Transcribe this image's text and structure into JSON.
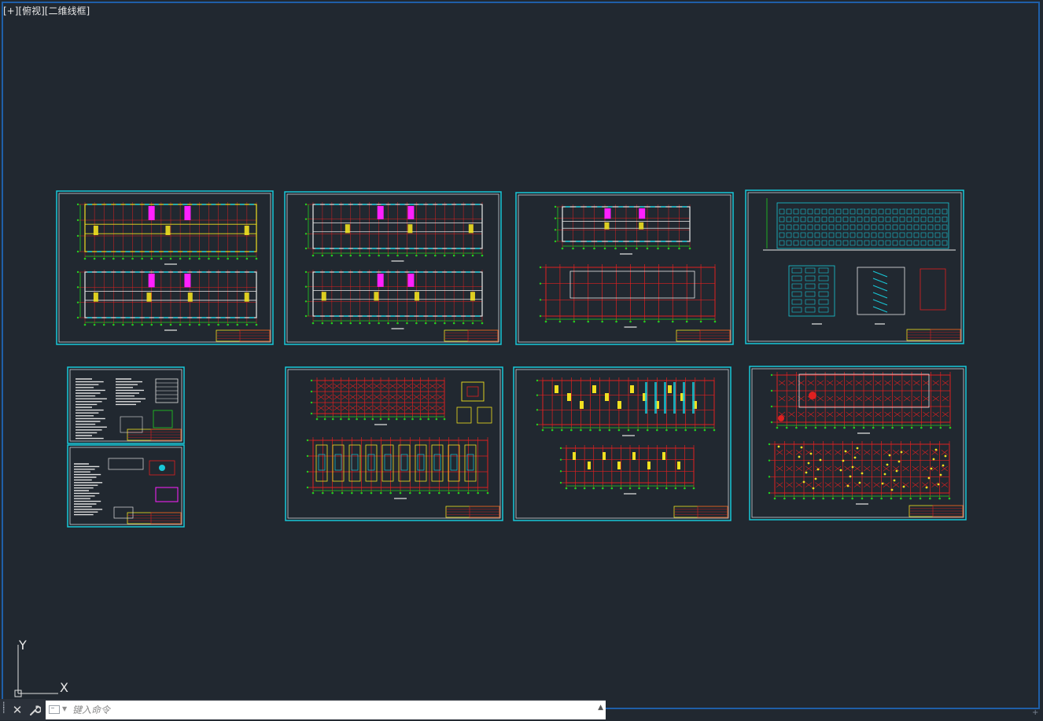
{
  "viewport": {
    "label_parts": [
      "[+]",
      "[俯视]",
      "[二维线框]"
    ],
    "background_color": "#212830"
  },
  "ucs": {
    "x_label": "X",
    "y_label": "Y"
  },
  "command_line": {
    "placeholder": "键入命令",
    "close_icon": "close-icon",
    "settings_icon": "wrench-icon",
    "prompt_icon": "command-prompt-icon",
    "history_icon": "chevron-up-icon"
  },
  "sheets": [
    {
      "id": "sheet-1",
      "kind": "floor-plans"
    },
    {
      "id": "sheet-2",
      "kind": "floor-plans"
    },
    {
      "id": "sheet-3",
      "kind": "plan-and-roof"
    },
    {
      "id": "sheet-4",
      "kind": "elevations-sections"
    },
    {
      "id": "sheet-5",
      "kind": "notes"
    },
    {
      "id": "sheet-6",
      "kind": "notes-details"
    },
    {
      "id": "sheet-7",
      "kind": "foundation-plans"
    },
    {
      "id": "sheet-8",
      "kind": "structural-plans"
    },
    {
      "id": "sheet-9",
      "kind": "reinforcement-plans"
    }
  ],
  "colors": {
    "sheet_border": "#18c8d8",
    "grid_red": "#e02020",
    "dim_green": "#20d020",
    "wall_white": "#e8e8e8",
    "highlight_magenta": "#ff20ff",
    "highlight_yellow": "#f0e020"
  }
}
